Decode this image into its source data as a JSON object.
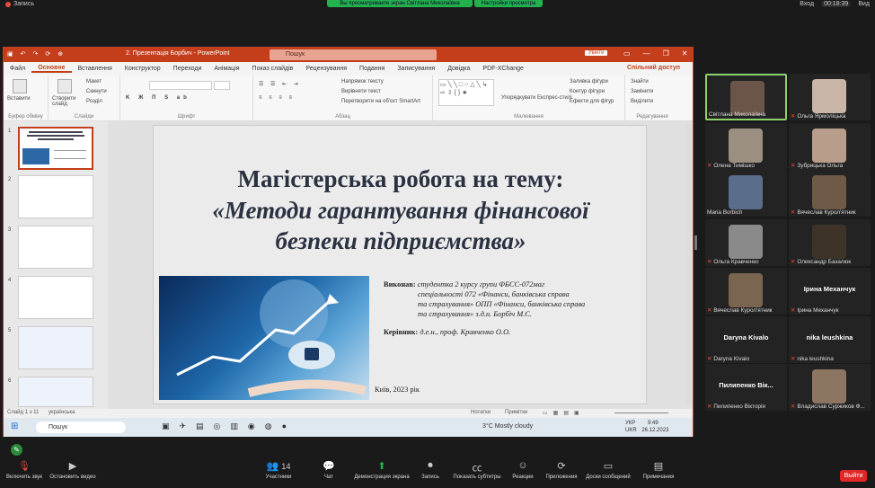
{
  "topbar": {
    "recording": "Запись",
    "share_banner": "Вы просматриваете экран Світлана Миколаївна",
    "view_settings": "Настройки просмотра",
    "login": "Вход",
    "timer": "00:18:39",
    "view": "Вид"
  },
  "ppt": {
    "quick": [
      "↶",
      "↷",
      "⟳",
      "⊕"
    ],
    "window_title": "2. Презентація Борбич - PowerPoint",
    "search_placeholder": "Пошук",
    "enter": "Увійти",
    "menu": [
      "Файл",
      "Основне",
      "Вставлення",
      "Конструктор",
      "Переходи",
      "Анімація",
      "Показ слайдів",
      "Рецензування",
      "Подання",
      "Записування",
      "Довідка",
      "PDF-XChange"
    ],
    "active_menu": "Основне",
    "share": "Спільний доступ",
    "ribbon": {
      "paste": "Вставити",
      "clipboard": "Буфер обміну",
      "new_slide": "Створити слайд",
      "layout": "Макет",
      "reset": "Скинути",
      "section": "Розділ",
      "slides": "Слайди",
      "font": "Шрифт",
      "paragraph": "Абзац",
      "text_dir": "Напрямок тексту",
      "align_text": "Вирівняти текст",
      "smartart": "Перетворити на об'єкт SmartArt",
      "arrange": "Упорядкувати",
      "quick_styles": "Експрес-стилі",
      "fill": "Заливка фігури",
      "outline": "Контур фігури",
      "effects": "Ефекти для фігур",
      "drawing": "Малювання",
      "find": "Знайти",
      "replace": "Замінити",
      "select": "Виділити",
      "editing": "Редагування"
    },
    "slides_count": 6,
    "slide": {
      "title1": "Магістерська робота на тему:",
      "title2": "«Методи гарантування фінансової",
      "title3": "безпеки підприємства»",
      "author_label": "Виконав:",
      "author_text1": "студентка 2 курсу групи ФБСС-072маг",
      "author_text2": "спеціальності 072 «Фінанси, банківська справа",
      "author_text3": "та страхування» ОПП «Фінанси, банківська справа",
      "author_text4": "та страхування» з.д.н. Борбіч М.С.",
      "supervisor_label": "Керівник:",
      "supervisor_text": "д.е.н., проф. Кравченко О.О.",
      "city": "Київ, 2023 рік"
    },
    "status": {
      "slide_info": "Слайд 1 з 11",
      "language": "українська",
      "notes": "Нотатки",
      "comments": "Примітки"
    },
    "taskbar": {
      "search": "Пошук",
      "weather": "3°C  Mostly cloudy",
      "lang": "УКР",
      "lang2": "UKR",
      "time": "9:49",
      "date": "26.12.2023"
    }
  },
  "participants": [
    {
      "name": "Світлана Миколаївна",
      "muted": false,
      "active": true
    },
    {
      "name": "Ольга Ярмоліцька",
      "muted": true
    },
    {
      "name": "Олена Тимішко",
      "muted": true
    },
    {
      "name": "Зубрицька Ольга",
      "muted": true
    },
    {
      "name": "Maria Borbich",
      "muted": false
    },
    {
      "name": "Вячеслав Курол'ятник",
      "muted": true
    },
    {
      "name": "Ольга Кравченко",
      "muted": true
    },
    {
      "name": "Олександр Базалюк",
      "muted": true
    },
    {
      "name": "Вячеслав Курол'ятник",
      "muted": true
    },
    {
      "name": "Ірина Механчук",
      "muted": true,
      "big": "Ірина Механчук"
    },
    {
      "name": "Daryna Kivalo",
      "muted": true,
      "big": "Daryna Kivalo"
    },
    {
      "name": "nika leushkina",
      "muted": true,
      "big": "nika leushkina"
    },
    {
      "name": "Пилипенко Вікторія",
      "muted": true,
      "big": "Пилипенко  Вік..."
    },
    {
      "name": "Владислав Суржиков Ф...",
      "muted": true
    }
  ],
  "bottom": {
    "mute": "Включить звук",
    "video": "Остановить видео",
    "participants": "Участники",
    "participants_count": "14",
    "chat": "Чат",
    "share": "Демонстрация экрана",
    "record": "Запись",
    "subtitles": "Показать субтитры",
    "reactions": "Реакции",
    "apps": "Приложения",
    "whiteboard": "Доски сообщений",
    "notes": "Примечания",
    "leave": "Выйти"
  }
}
